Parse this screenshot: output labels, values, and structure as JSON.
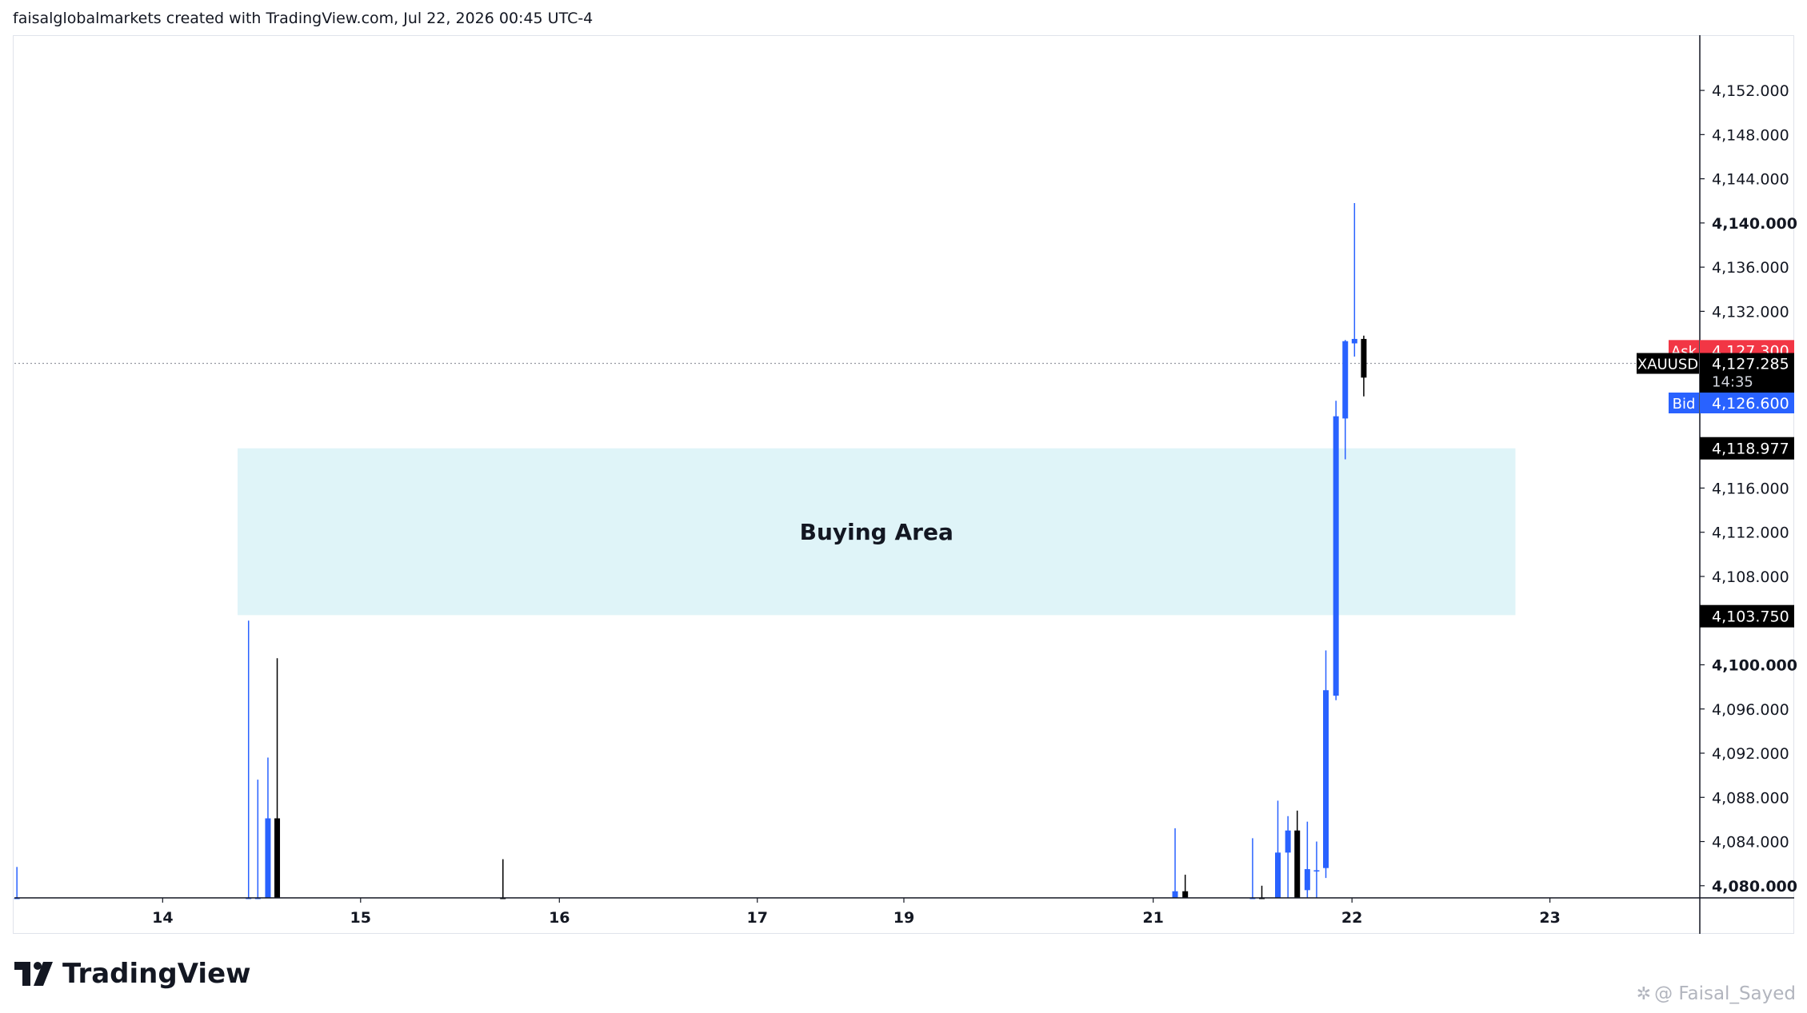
{
  "header": {
    "caption": "faisalglobalmarkets created with TradingView.com, Jul 22, 2026 00:45 UTC-4"
  },
  "footer": {
    "brand": "TradingView",
    "watermark": "@ Faisal_Sayed"
  },
  "colors": {
    "bull": "#2962ff",
    "bear": "#000000",
    "zone": "#dff4f8",
    "ask": "#f23645",
    "bid": "#2962ff",
    "axis": "#131722"
  },
  "chart_data": {
    "type": "candlestick",
    "symbol": "XAUUSD",
    "ylim": [
      4078.9,
      4157.0
    ],
    "y_ticks": [
      4080,
      4084,
      4088,
      4092,
      4096,
      4100,
      4104,
      4108,
      4112,
      4116,
      4120,
      4124,
      4128,
      4132,
      4136,
      4140,
      4144,
      4148,
      4152
    ],
    "y_tick_labels": [
      "4,080.000",
      "4,084.000",
      "4,088.000",
      "4,092.000",
      "4,096.000",
      "4,100.000",
      "",
      "4,108.000",
      "4,112.000",
      "4,116.000",
      "4,120.000",
      "",
      "",
      "4,132.000",
      "4,136.000",
      "4,140.000",
      "4,144.000",
      "4,148.000",
      "4,152.000"
    ],
    "bold_tick_labels": [
      "4,080.000",
      "4,100.000",
      "4,140.000"
    ],
    "x_ticks": [
      {
        "label": "14",
        "pos": 0.088
      },
      {
        "label": "15",
        "pos": 0.2055
      },
      {
        "label": "16",
        "pos": 0.3235
      },
      {
        "label": "17",
        "pos": 0.441
      },
      {
        "label": "19",
        "pos": 0.528
      },
      {
        "label": "21",
        "pos": 0.676
      },
      {
        "label": "22",
        "pos": 0.794
      },
      {
        "label": "23",
        "pos": 0.9115
      }
    ],
    "candles": [
      {
        "t": 0.0015,
        "o": 4078.9,
        "h": 4081.7,
        "l": 4078.9,
        "c": 4078.9,
        "dir": "up"
      },
      {
        "t": 0.139,
        "o": 4078.9,
        "h": 4104.0,
        "l": 4078.9,
        "c": 4078.9,
        "dir": "up"
      },
      {
        "t": 0.1445,
        "o": 4078.9,
        "h": 4089.6,
        "l": 4078.9,
        "c": 4078.9,
        "dir": "up"
      },
      {
        "t": 0.1505,
        "o": 4078.9,
        "h": 4091.6,
        "l": 4078.9,
        "c": 4086.1,
        "dir": "up"
      },
      {
        "t": 0.156,
        "o": 4086.1,
        "h": 4100.6,
        "l": 4078.9,
        "c": 4078.9,
        "dir": "down"
      },
      {
        "t": 0.29,
        "o": 4078.9,
        "h": 4082.4,
        "l": 4078.9,
        "c": 4078.9,
        "dir": "down"
      },
      {
        "t": 0.689,
        "o": 4078.9,
        "h": 4085.2,
        "l": 4078.9,
        "c": 4079.5,
        "dir": "up"
      },
      {
        "t": 0.695,
        "o": 4079.5,
        "h": 4081.0,
        "l": 4078.9,
        "c": 4078.9,
        "dir": "down"
      },
      {
        "t": 0.735,
        "o": 4078.9,
        "h": 4084.3,
        "l": 4078.9,
        "c": 4078.9,
        "dir": "up"
      },
      {
        "t": 0.7405,
        "o": 4078.9,
        "h": 4080.0,
        "l": 4078.9,
        "c": 4078.9,
        "dir": "down"
      },
      {
        "t": 0.75,
        "o": 4078.9,
        "h": 4087.7,
        "l": 4078.9,
        "c": 4083.0,
        "dir": "up"
      },
      {
        "t": 0.756,
        "o": 4083.0,
        "h": 4086.3,
        "l": 4078.9,
        "c": 4085.0,
        "dir": "up"
      },
      {
        "t": 0.7615,
        "o": 4085.0,
        "h": 4086.8,
        "l": 4078.9,
        "c": 4078.9,
        "dir": "down"
      },
      {
        "t": 0.7675,
        "o": 4079.6,
        "h": 4085.8,
        "l": 4078.9,
        "c": 4081.5,
        "dir": "up"
      },
      {
        "t": 0.773,
        "o": 4081.3,
        "h": 4084.0,
        "l": 4078.9,
        "c": 4081.4,
        "dir": "up"
      },
      {
        "t": 0.7785,
        "o": 4081.6,
        "h": 4101.3,
        "l": 4080.7,
        "c": 4097.7,
        "dir": "up"
      },
      {
        "t": 0.7845,
        "o": 4097.2,
        "h": 4123.9,
        "l": 4096.8,
        "c": 4122.5,
        "dir": "up"
      },
      {
        "t": 0.79,
        "o": 4122.3,
        "h": 4129.4,
        "l": 4118.6,
        "c": 4129.3,
        "dir": "up"
      },
      {
        "t": 0.7955,
        "o": 4129.1,
        "h": 4141.8,
        "l": 4127.9,
        "c": 4129.5,
        "dir": "up"
      },
      {
        "t": 0.801,
        "o": 4129.5,
        "h": 4129.8,
        "l": 4124.3,
        "c": 4126.0,
        "dir": "down"
      }
    ],
    "zone": {
      "label": "Buying Area",
      "top": 4119.6,
      "bottom": 4104.5,
      "x_start": 0.1325,
      "x_end": 0.891
    },
    "price_line": 4127.285,
    "price_tags": {
      "ask": {
        "label": "Ask",
        "value": "4,127.300",
        "price": 4127.3
      },
      "last": {
        "label": "XAUUSD",
        "value": "4,127.285",
        "sub": "14:35",
        "price": 4127.285
      },
      "bid": {
        "label": "Bid",
        "value": "4,126.600",
        "price": 4126.6
      },
      "zone_top": {
        "value": "4,118.977",
        "price": 4119.6
      },
      "zone_bottom": {
        "value": "4,103.750",
        "price": 4104.4
      }
    }
  }
}
